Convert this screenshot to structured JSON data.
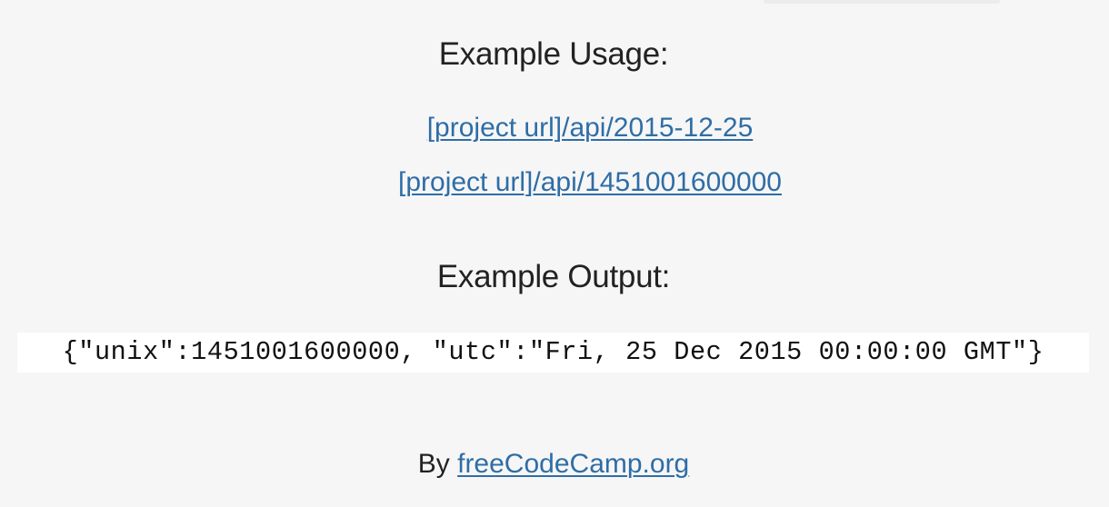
{
  "usage": {
    "heading": "Example Usage:",
    "links": [
      "[project url]/api/2015-12-25",
      "[project url]/api/1451001600000"
    ]
  },
  "output": {
    "heading": "Example Output:",
    "code": "{\"unix\":1451001600000, \"utc\":\"Fri, 25 Dec 2015 00:00:00 GMT\"}"
  },
  "footer": {
    "prefix": "By",
    "link_text": "freeCodeCamp.org"
  },
  "colors": {
    "background": "#f6f6f6",
    "link": "#2f6da6",
    "text": "#222222",
    "code_background": "#ffffff"
  }
}
